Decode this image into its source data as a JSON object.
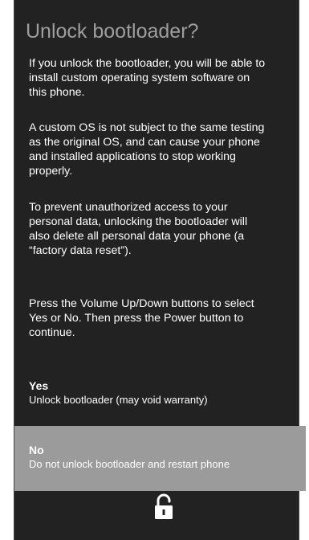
{
  "dialog": {
    "title": "Unlock bootloader?",
    "paragraphs": [
      "If you unlock the bootloader, you will be able to install custom operating system software on this phone.",
      "A custom OS is not subject to the same testing as the original OS, and can cause your phone and installed applications to stop working properly.",
      "To prevent unauthorized access to your personal data, unlocking the bootloader will also delete all personal data your phone (a “factory data reset”).",
      "Press the Volume Up/Down buttons to select Yes or No. Then press the Power button to continue."
    ]
  },
  "options": {
    "yes": {
      "label": "Yes",
      "description": "Unlock bootloader (may void warranty)"
    },
    "no": {
      "label": "No",
      "description": "Do not unlock bootloader and restart phone",
      "selected": true
    }
  },
  "icons": {
    "status": "unlocked-padlock-icon"
  },
  "colors": {
    "background": "#222222",
    "title": "#9e9e9e",
    "text": "#ffffff",
    "selection": "#9b9b9b"
  }
}
